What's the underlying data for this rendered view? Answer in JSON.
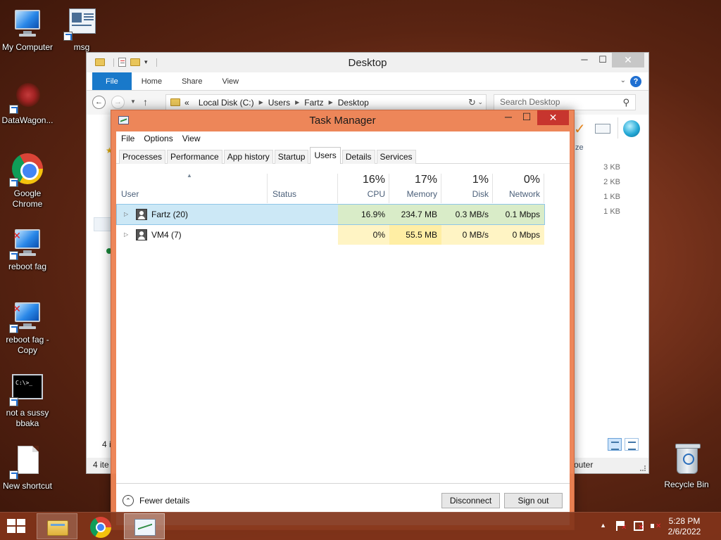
{
  "desktop": {
    "icons": [
      {
        "label": "My Computer"
      },
      {
        "label": "msg"
      },
      {
        "label": "DataWagon..."
      },
      {
        "label": "Google Chrome"
      },
      {
        "label": "reboot fag"
      },
      {
        "label": "reboot fag - Copy"
      },
      {
        "label": "not a sussy bbaka"
      },
      {
        "label": "New shortcut"
      },
      {
        "label": "Recycle Bin"
      }
    ],
    "cmd_text": "C:\\>_"
  },
  "explorer": {
    "title": "Desktop",
    "ribbon_tabs": [
      "File",
      "Home",
      "Share",
      "View"
    ],
    "help": "?",
    "address": {
      "prefix": "«",
      "crumbs": [
        "Local Disk (C:)",
        "Users",
        "Fartz",
        "Desktop"
      ]
    },
    "search_placeholder": "Search Desktop",
    "column_header_partial": "ze",
    "sizes": [
      "3 KB",
      "2 KB",
      "1 KB",
      "1 KB"
    ],
    "side_count_partial": "4 i",
    "status_left": "4 ite",
    "status_right": "outer"
  },
  "task_manager": {
    "title": "Task Manager",
    "menu": [
      "File",
      "Options",
      "View"
    ],
    "tabs": [
      "Processes",
      "Performance",
      "App history",
      "Startup",
      "Users",
      "Details",
      "Services"
    ],
    "active_tab": "Users",
    "columns": {
      "user": "User",
      "status": "Status",
      "cpu": {
        "pct": "16%",
        "label": "CPU"
      },
      "memory": {
        "pct": "17%",
        "label": "Memory"
      },
      "disk": {
        "pct": "1%",
        "label": "Disk"
      },
      "network": {
        "pct": "0%",
        "label": "Network"
      }
    },
    "rows": [
      {
        "user": "Fartz (20)",
        "status": "",
        "cpu": "16.9%",
        "memory": "234.7 MB",
        "disk": "0.3 MB/s",
        "network": "0.1 Mbps"
      },
      {
        "user": "VM4 (7)",
        "status": "",
        "cpu": "0%",
        "memory": "55.5 MB",
        "disk": "0 MB/s",
        "network": "0 Mbps"
      }
    ],
    "fewer_details": "Fewer details",
    "buttons": {
      "disconnect": "Disconnect",
      "sign_out": "Sign out"
    }
  },
  "taskbar": {
    "time": "5:28 PM",
    "date": "2/6/2022"
  }
}
